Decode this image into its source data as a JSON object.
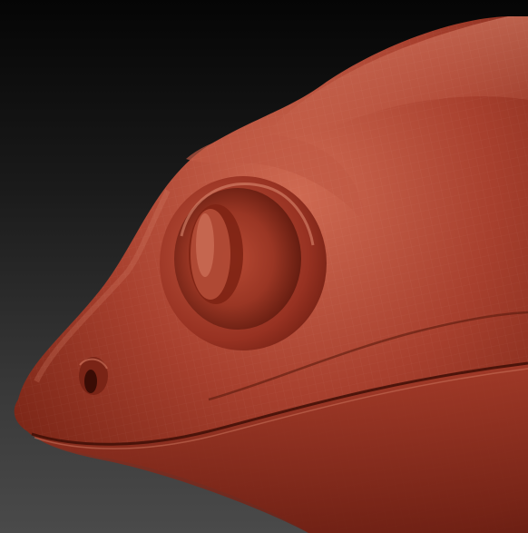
{
  "viewport": {
    "subject": "sculpted-reptile-head",
    "material_color": "#a8402e",
    "highlight_color": "#e0876f",
    "shadow_color": "#4a1208",
    "background_top": "#050505",
    "background_bottom": "#4a4a4a"
  }
}
